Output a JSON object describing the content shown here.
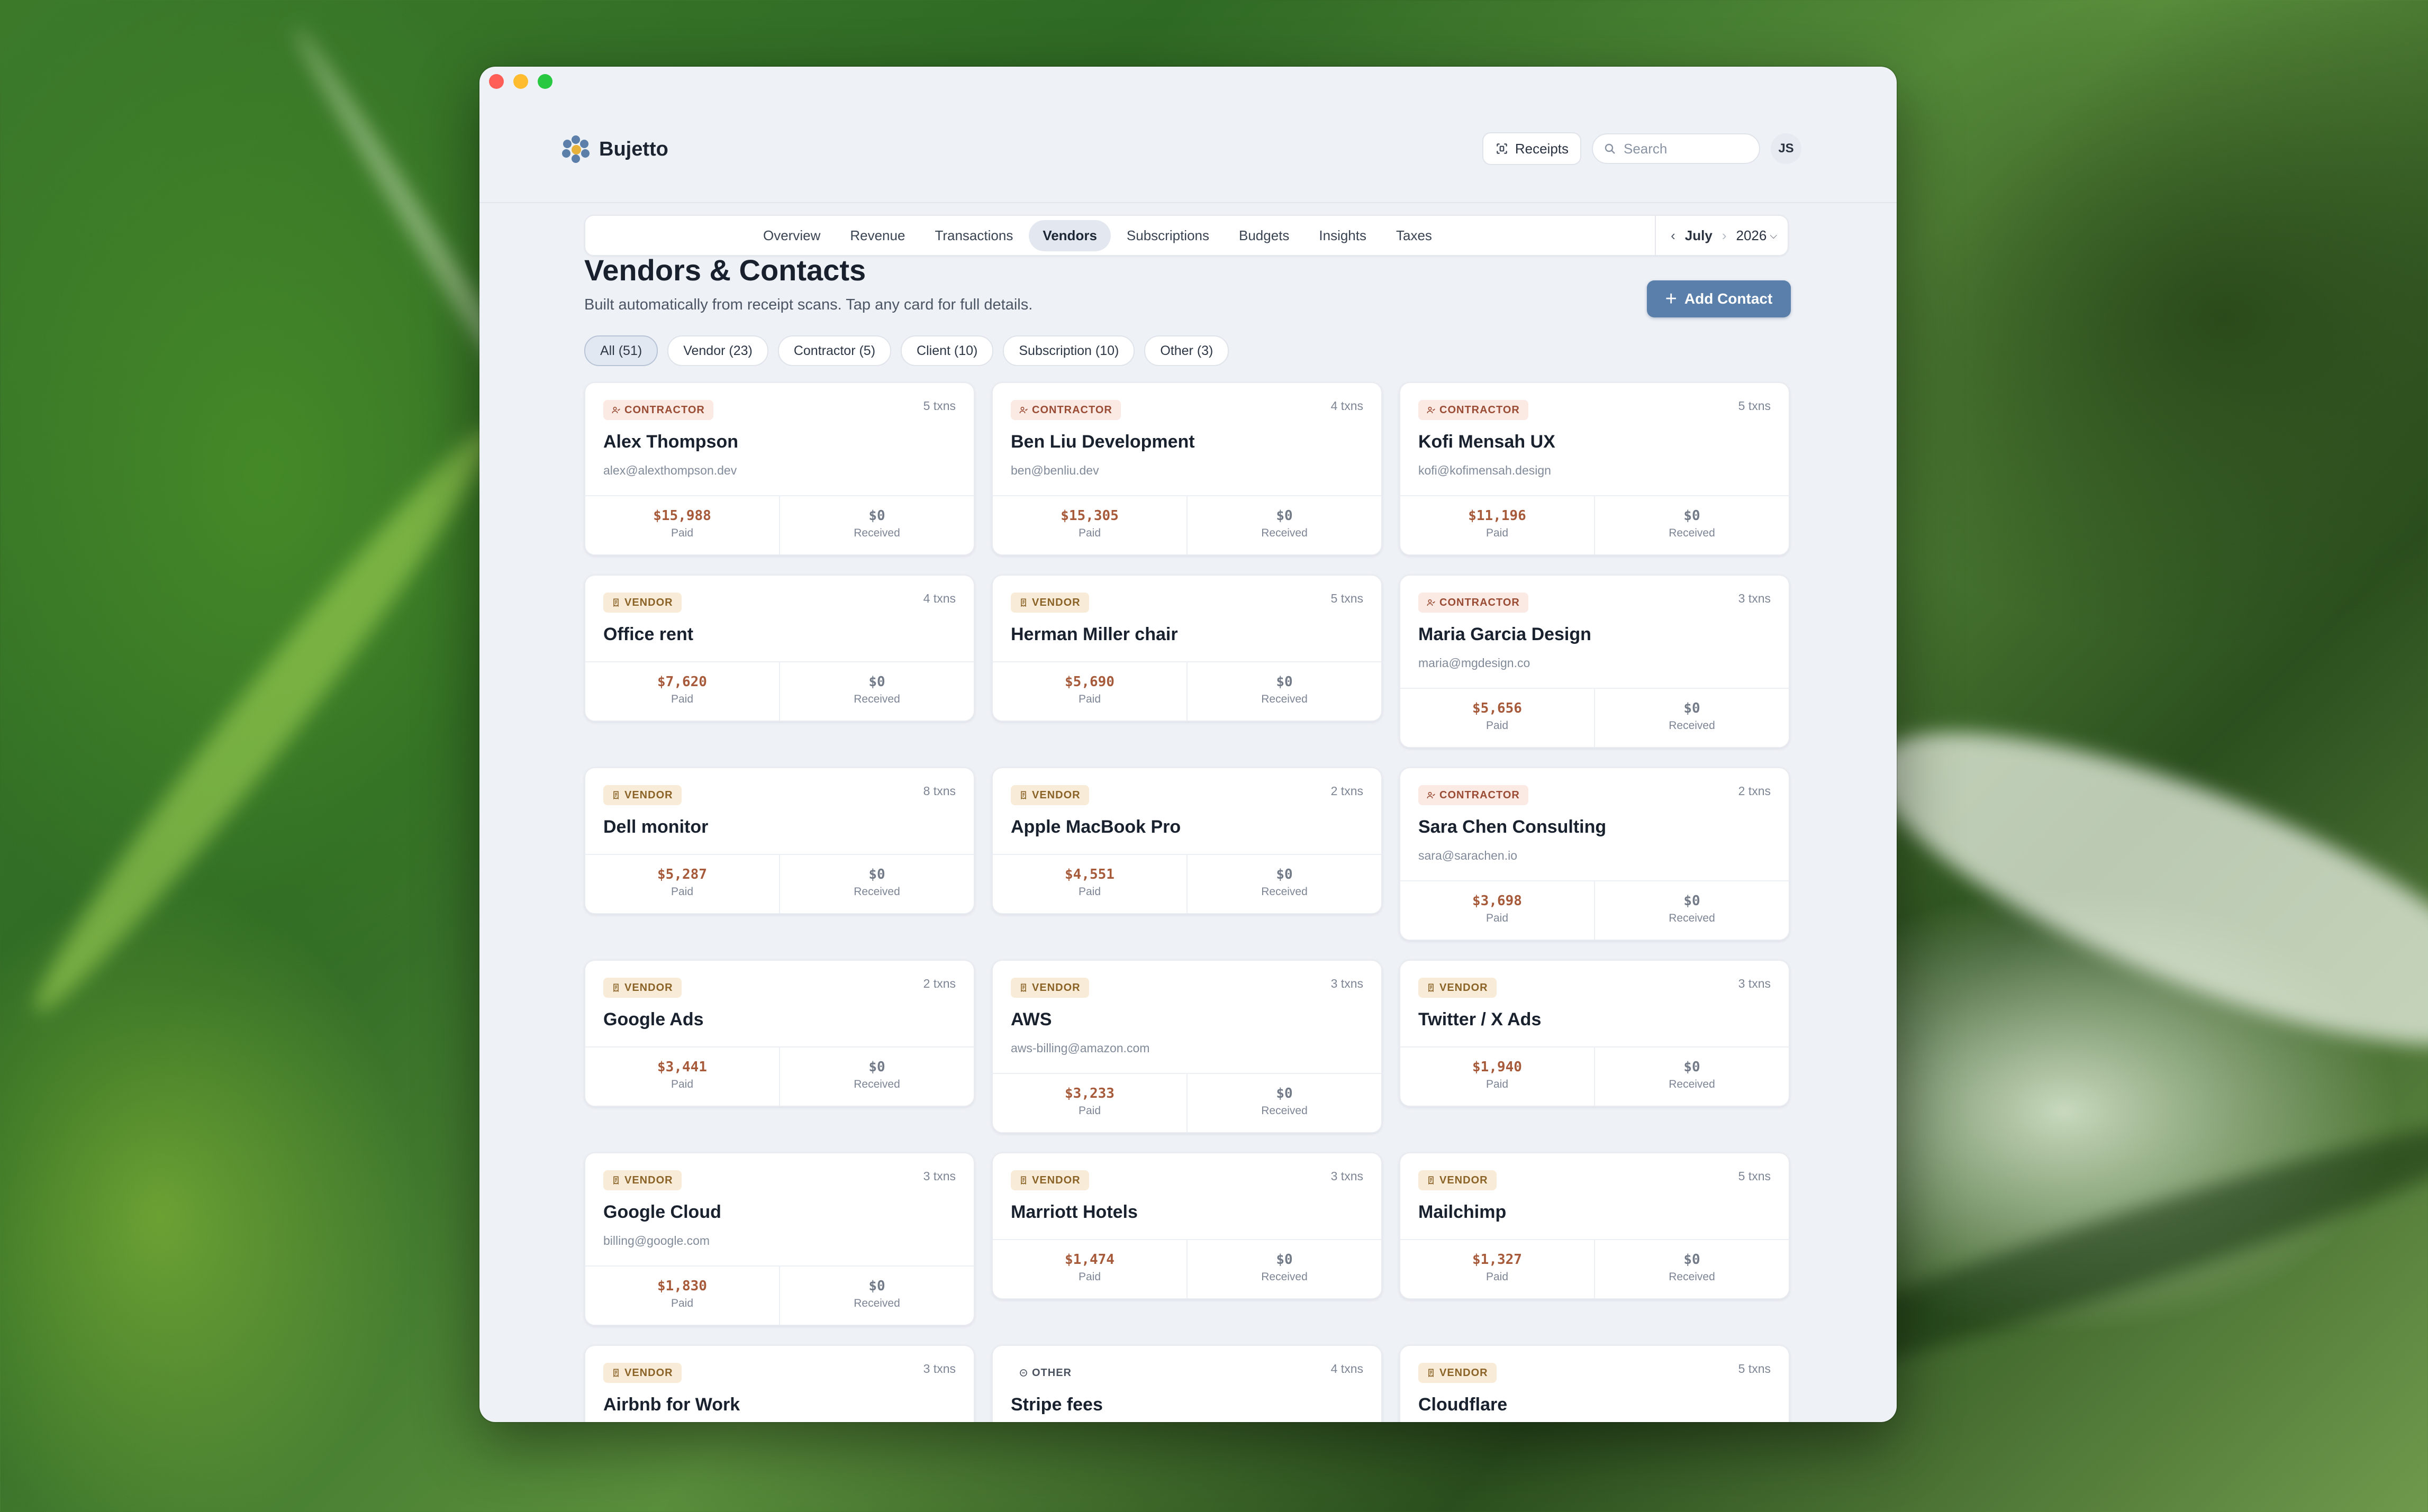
{
  "window": {
    "title": ""
  },
  "app": {
    "name": "Bujetto"
  },
  "topbar": {
    "receipts_label": "Receipts",
    "search_placeholder": "Search",
    "avatar_initials": "JS"
  },
  "nav": {
    "tabs": [
      "Overview",
      "Revenue",
      "Transactions",
      "Vendors",
      "Subscriptions",
      "Budgets",
      "Insights",
      "Taxes"
    ],
    "active_tab": "Vendors",
    "period": {
      "month": "July",
      "year": "2026"
    }
  },
  "page": {
    "title": "Vendors & Contacts",
    "subtitle": "Built automatically from receipt scans. Tap any card for full details.",
    "add_button": "Add Contact"
  },
  "filters": [
    "All (51)",
    "Vendor (23)",
    "Contractor (5)",
    "Client (10)",
    "Subscription (10)",
    "Other (3)"
  ],
  "active_filter": "All (51)",
  "stat_labels": {
    "paid": "Paid",
    "received": "Received"
  },
  "cards": [
    {
      "type": "CONTRACTOR",
      "icon": "person-icon",
      "txns": "5 txns",
      "name": "Alex Thompson",
      "email": "alex@alexthompson.dev",
      "paid": "$15,988",
      "received": "$0"
    },
    {
      "type": "CONTRACTOR",
      "icon": "person-icon",
      "txns": "4 txns",
      "name": "Ben Liu Development",
      "email": "ben@benliu.dev",
      "paid": "$15,305",
      "received": "$0"
    },
    {
      "type": "CONTRACTOR",
      "icon": "person-icon",
      "txns": "5 txns",
      "name": "Kofi Mensah UX",
      "email": "kofi@kofimensah.design",
      "paid": "$11,196",
      "received": "$0"
    },
    {
      "type": "VENDOR",
      "icon": "receipt-icon",
      "txns": "4 txns",
      "name": "Office rent",
      "email": "",
      "paid": "$7,620",
      "received": "$0"
    },
    {
      "type": "VENDOR",
      "icon": "receipt-icon",
      "txns": "5 txns",
      "name": "Herman Miller chair",
      "email": "",
      "paid": "$5,690",
      "received": "$0"
    },
    {
      "type": "CONTRACTOR",
      "icon": "person-icon",
      "txns": "3 txns",
      "name": "Maria Garcia Design",
      "email": "maria@mgdesign.co",
      "paid": "$5,656",
      "received": "$0"
    },
    {
      "type": "VENDOR",
      "icon": "receipt-icon",
      "txns": "8 txns",
      "name": "Dell monitor",
      "email": "",
      "paid": "$5,287",
      "received": "$0"
    },
    {
      "type": "VENDOR",
      "icon": "receipt-icon",
      "txns": "2 txns",
      "name": "Apple MacBook Pro",
      "email": "",
      "paid": "$4,551",
      "received": "$0"
    },
    {
      "type": "CONTRACTOR",
      "icon": "person-icon",
      "txns": "2 txns",
      "name": "Sara Chen Consulting",
      "email": "sara@sarachen.io",
      "paid": "$3,698",
      "received": "$0"
    },
    {
      "type": "VENDOR",
      "icon": "receipt-icon",
      "txns": "2 txns",
      "name": "Google Ads",
      "email": "",
      "paid": "$3,441",
      "received": "$0"
    },
    {
      "type": "VENDOR",
      "icon": "receipt-icon",
      "txns": "3 txns",
      "name": "AWS",
      "email": "aws-billing@amazon.com",
      "paid": "$3,233",
      "received": "$0"
    },
    {
      "type": "VENDOR",
      "icon": "receipt-icon",
      "txns": "3 txns",
      "name": "Twitter / X Ads",
      "email": "",
      "paid": "$1,940",
      "received": "$0"
    },
    {
      "type": "VENDOR",
      "icon": "receipt-icon",
      "txns": "3 txns",
      "name": "Google Cloud",
      "email": "billing@google.com",
      "paid": "$1,830",
      "received": "$0"
    },
    {
      "type": "VENDOR",
      "icon": "receipt-icon",
      "txns": "3 txns",
      "name": "Marriott Hotels",
      "email": "",
      "paid": "$1,474",
      "received": "$0"
    },
    {
      "type": "VENDOR",
      "icon": "receipt-icon",
      "txns": "5 txns",
      "name": "Mailchimp",
      "email": "",
      "paid": "$1,327",
      "received": "$0"
    },
    {
      "type": "VENDOR",
      "icon": "receipt-icon",
      "txns": "3 txns",
      "name": "Airbnb for Work",
      "email": "",
      "paid": "",
      "received": ""
    },
    {
      "type": "OTHER",
      "icon": "circle-minus-icon",
      "txns": "4 txns",
      "name": "Stripe fees",
      "email": "",
      "paid": "",
      "received": ""
    },
    {
      "type": "VENDOR",
      "icon": "receipt-icon",
      "txns": "5 txns",
      "name": "Cloudflare",
      "email": "",
      "paid": "",
      "received": ""
    }
  ],
  "colors": {
    "accent": "#5a7fab",
    "paid": "#a75a3a",
    "contractor_badge": "#fbe9e3",
    "vendor_badge": "#f8ecd8"
  }
}
